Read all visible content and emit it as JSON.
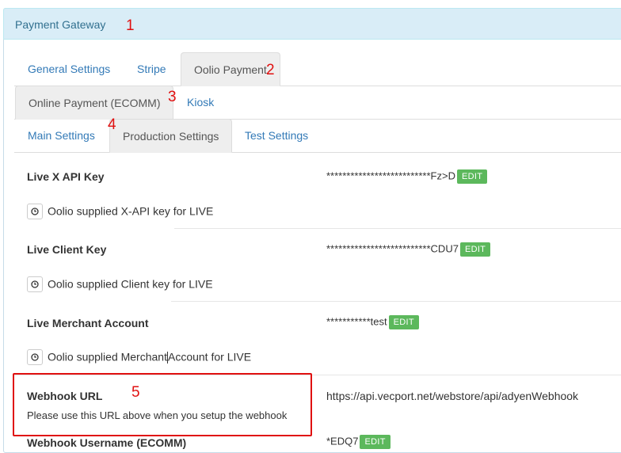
{
  "panel": {
    "title": "Payment Gateway"
  },
  "annotations": {
    "a1": "1",
    "a2": "2",
    "a3": "3",
    "a4": "4",
    "a5": "5"
  },
  "tabs_level1": [
    {
      "label": "General Settings"
    },
    {
      "label": "Stripe"
    },
    {
      "label": "Oolio Payment"
    }
  ],
  "tabs_level2": [
    {
      "label": "Online Payment (ECOMM)"
    },
    {
      "label": "Kiosk"
    }
  ],
  "tabs_level3": [
    {
      "label": "Main Settings"
    },
    {
      "label": "Production Settings"
    },
    {
      "label": "Test Settings"
    }
  ],
  "fields": {
    "x_api_key": {
      "label": "Live X API Key",
      "value": "**************************Fz>D",
      "edit": "EDIT",
      "help": "Oolio supplied X-API key for LIVE"
    },
    "client_key": {
      "label": "Live Client Key",
      "value": "**************************CDU7",
      "edit": "EDIT",
      "help": "Oolio supplied Client key for LIVE"
    },
    "merchant_account": {
      "label": "Live Merchant Account",
      "value": "***********test",
      "edit": "EDIT",
      "help_before": "Oolio supplied Merchant",
      "help_after": "Account for LIVE"
    },
    "webhook_url": {
      "label": "Webhook URL",
      "description": "Please use this URL above when you setup the webhook",
      "value": "https://api.vecport.net/webstore/api/adyenWebhook"
    },
    "webhook_username": {
      "label": "Webhook Username (ECOMM)",
      "value": "*EDQ7",
      "edit": "EDIT"
    }
  },
  "colors": {
    "accent_link": "#337ab7",
    "heading_bg": "#d9edf7",
    "edit_green": "#5cb85c",
    "annotation_red": "#e01010"
  }
}
